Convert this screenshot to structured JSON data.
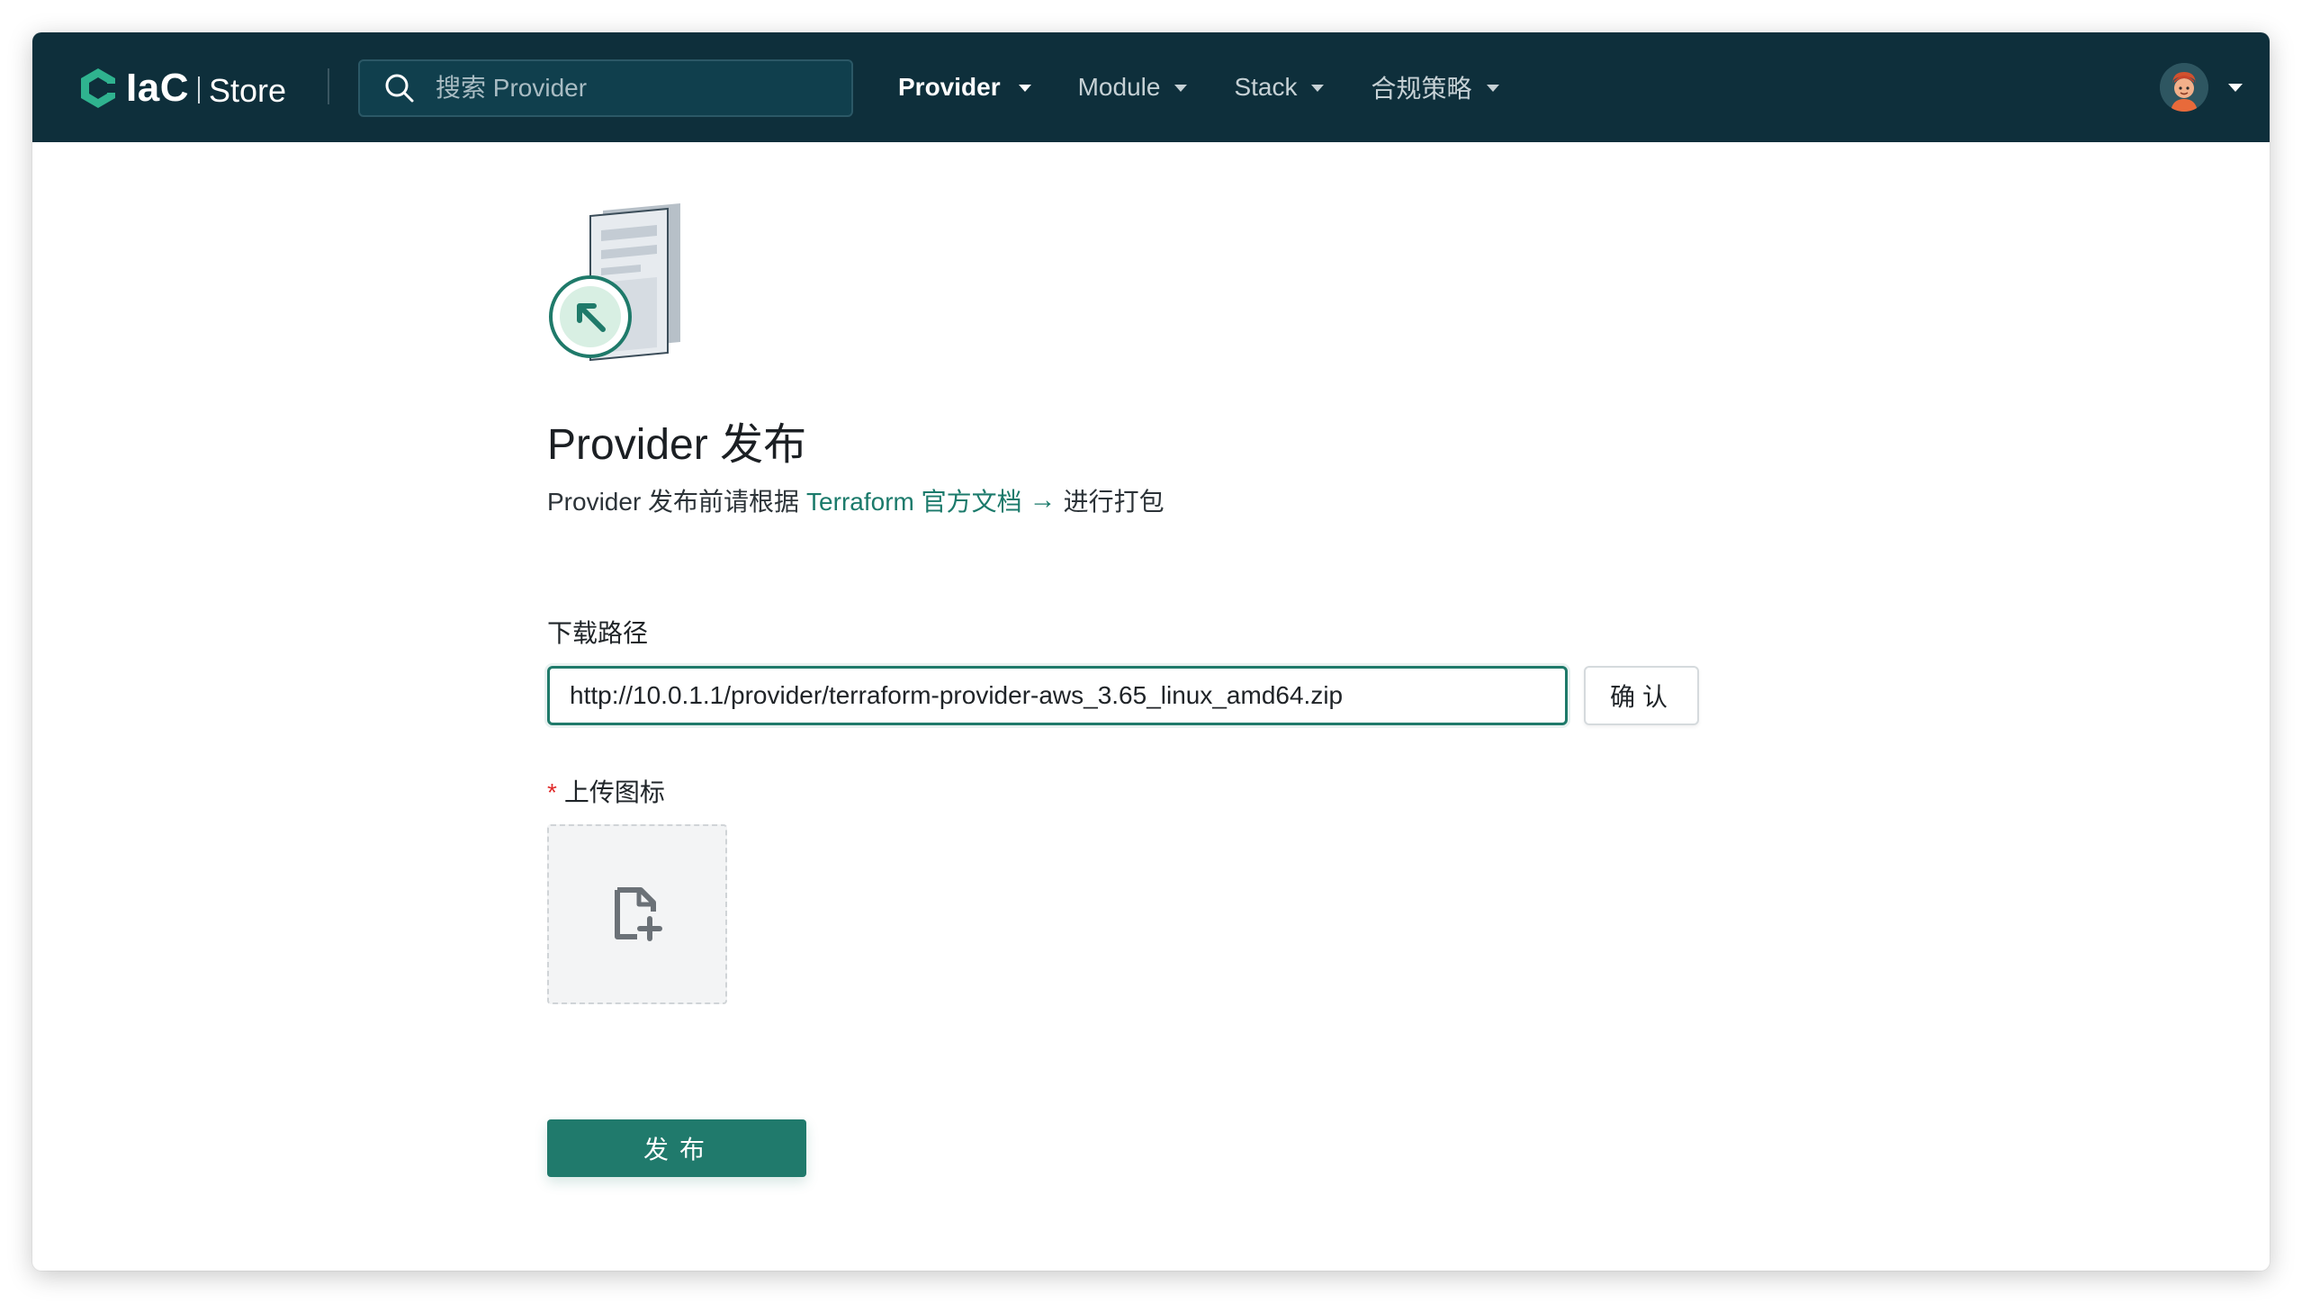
{
  "header": {
    "logo": {
      "brand": "IaC",
      "product": "Store"
    },
    "search": {
      "placeholder": "搜索 Provider",
      "icon": "search-icon"
    },
    "nav": [
      {
        "label": "Provider",
        "active": true
      },
      {
        "label": "Module",
        "active": false
      },
      {
        "label": "Stack",
        "active": false
      },
      {
        "label": "合规策略",
        "active": false
      }
    ],
    "user": {
      "avatar": "user-avatar"
    }
  },
  "main": {
    "title": "Provider 发布",
    "subtitle_prefix": "Provider 发布前请根据",
    "subtitle_link": "Terraform 官方文档",
    "subtitle_arrow": "→",
    "subtitle_suffix": "进行打包",
    "download_label": "下载路径",
    "download_value": "http://10.0.1.1/provider/terraform-provider-aws_3.65_linux_amd64.zip",
    "confirm_label": "确认",
    "upload_required": "*",
    "upload_label": "上传图标",
    "publish_label": "发布"
  },
  "colors": {
    "header_bg": "#0e2f3b",
    "accent": "#207a6c",
    "link": "#1b7a6b",
    "required": "#e02b2b"
  }
}
